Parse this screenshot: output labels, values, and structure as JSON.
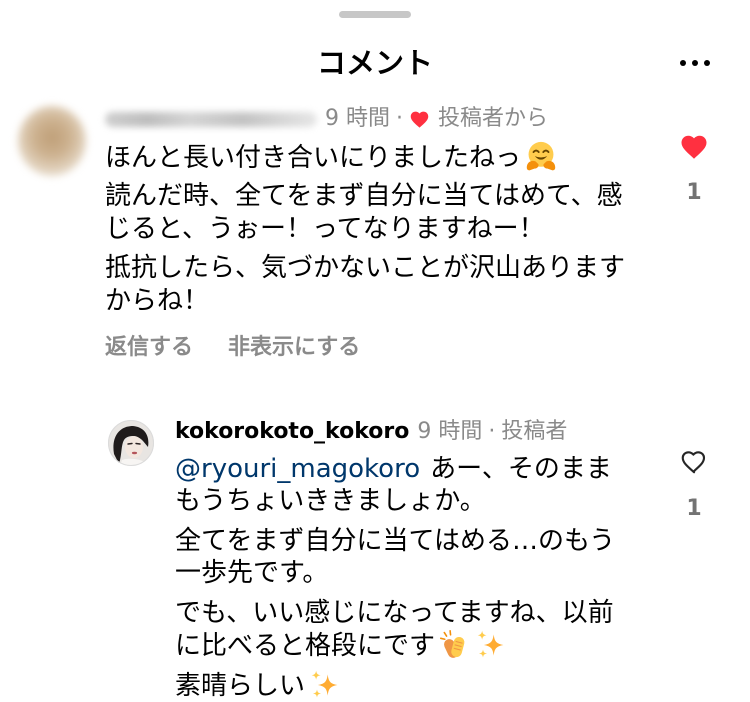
{
  "sheet": {
    "title": "コメント",
    "drag_handle_icon": "drag-handle-icon",
    "more_icon": "more-horizontal-icon"
  },
  "colors": {
    "text": "#000000",
    "meta": "#8a8a8a",
    "like_red": "#ff3040",
    "mention": "#00376b",
    "handle": "#c7c7c7",
    "background": "#ffffff"
  },
  "comments": [
    {
      "avatar_icon": "blurred-avatar",
      "time": "9 時間",
      "separator": "·",
      "author_like_icon": "heart-filled-icon",
      "author_badge": "投稿者から",
      "paragraphs": [
        [
          {
            "text": "ほんと長い付き合いにりましたねっ",
            "emoji": [
              "hugging-face-emoji"
            ]
          }
        ],
        [
          {
            "text": "読んだ時、全てをまず自分に当てはめて、感"
          },
          {
            "text": "じると、うぉー！ってなりますねー！"
          }
        ],
        [
          {
            "text": "抵抗したら、気づかないことが沢山あります"
          },
          {
            "text": "からね！"
          }
        ]
      ],
      "actions": {
        "reply": "返信する",
        "hide": "非表示にする"
      },
      "like": {
        "icon": "heart-filled-icon",
        "liked": true,
        "count": "1"
      }
    },
    {
      "avatar_icon": "profile-photo-avatar",
      "username": "kokorokoto_kokoro",
      "time": "9 時間",
      "separator": "·",
      "author_badge": "投稿者",
      "paragraphs": [
        [
          {
            "mention": "@ryouri_magokoro",
            "text": "あー、そのまま"
          },
          {
            "text": "もうちょいききましょか。"
          }
        ],
        [
          {
            "text": "全てをまず自分に当てはめる…のもう"
          },
          {
            "text": "一歩先です。"
          }
        ],
        [
          {
            "text": "でも、いい感じになってますね、以前"
          },
          {
            "text": "に比べると格段にです",
            "emoji": [
              "clapping-hands-emoji",
              "sparkles-emoji"
            ]
          }
        ],
        [
          {
            "text": "素晴らしい",
            "emoji": [
              "sparkles-emoji"
            ]
          }
        ]
      ],
      "like": {
        "icon": "heart-outline-icon",
        "liked": false,
        "count": "1"
      }
    }
  ]
}
